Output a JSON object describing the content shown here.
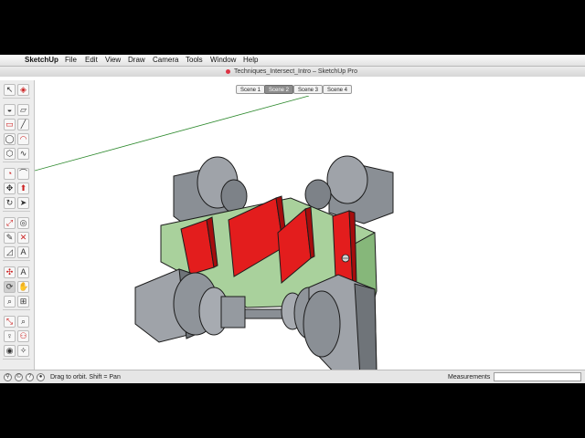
{
  "menubar": {
    "apple_glyph": "",
    "app_name": "SketchUp",
    "items": [
      "File",
      "Edit",
      "View",
      "Draw",
      "Camera",
      "Tools",
      "Window",
      "Help"
    ]
  },
  "window": {
    "title": "Techniques_Intersect_Intro – SketchUp Pro"
  },
  "scenes": {
    "tabs": [
      "Scene 1",
      "Scene 2",
      "Scene 3",
      "Scene 4"
    ],
    "active_index": 1
  },
  "toolbar": {
    "tools": [
      {
        "name": "select-tool",
        "glyph": "↖"
      },
      {
        "name": "make-component-tool",
        "glyph": "◈"
      },
      {
        "name": "paint-bucket-tool",
        "glyph": "◒"
      },
      {
        "name": "eraser-tool",
        "glyph": "▱"
      },
      {
        "name": "rectangle-tool",
        "glyph": "▭"
      },
      {
        "name": "line-tool",
        "glyph": "╱"
      },
      {
        "name": "circle-tool",
        "glyph": "◯"
      },
      {
        "name": "arc-tool",
        "glyph": "◠"
      },
      {
        "name": "polygon-tool",
        "glyph": "⬡"
      },
      {
        "name": "freehand-tool",
        "glyph": "∿"
      },
      {
        "name": "pie-tool",
        "glyph": "◔"
      },
      {
        "name": "arc2-tool",
        "glyph": "⌒"
      },
      {
        "name": "move-tool",
        "glyph": "✥"
      },
      {
        "name": "push-pull-tool",
        "glyph": "⬆"
      },
      {
        "name": "rotate-tool",
        "glyph": "↻"
      },
      {
        "name": "follow-me-tool",
        "glyph": "➤"
      },
      {
        "name": "scale-tool",
        "glyph": "⤢"
      },
      {
        "name": "offset-tool",
        "glyph": "◎"
      },
      {
        "name": "tape-measure-tool",
        "glyph": "✎"
      },
      {
        "name": "dimension-tool",
        "glyph": "✕"
      },
      {
        "name": "protractor-tool",
        "glyph": "◿"
      },
      {
        "name": "text-tool",
        "glyph": "A"
      },
      {
        "name": "axes-tool",
        "glyph": "✣"
      },
      {
        "name": "3d-text-tool",
        "glyph": "A"
      },
      {
        "name": "orbit-tool",
        "glyph": "⟳"
      },
      {
        "name": "pan-tool",
        "glyph": "✋"
      },
      {
        "name": "zoom-tool",
        "glyph": "⌕"
      },
      {
        "name": "zoom-window-tool",
        "glyph": "⊞"
      },
      {
        "name": "zoom-extents-tool",
        "glyph": "⤡"
      },
      {
        "name": "previous-view-tool",
        "glyph": "⌕"
      },
      {
        "name": "position-camera-tool",
        "glyph": "♀"
      },
      {
        "name": "walk-tool",
        "glyph": "⚇"
      },
      {
        "name": "look-around-tool",
        "glyph": "◉"
      },
      {
        "name": "section-plane-tool",
        "glyph": "✧"
      }
    ]
  },
  "status": {
    "message": "Drag to orbit.  Shift = Pan",
    "measurements_label": "Measurements",
    "measurements_value": ""
  },
  "colors": {
    "block_top": "#a9d19c",
    "block_side": "#86b77a",
    "fin_front": "#e31d1d",
    "fin_side": "#a50d0d",
    "wheel_front": "#9fa3a9",
    "wheel_side": "#6f7479",
    "outline": "#1c1c1c",
    "axis_green": "#2e8a2e"
  }
}
